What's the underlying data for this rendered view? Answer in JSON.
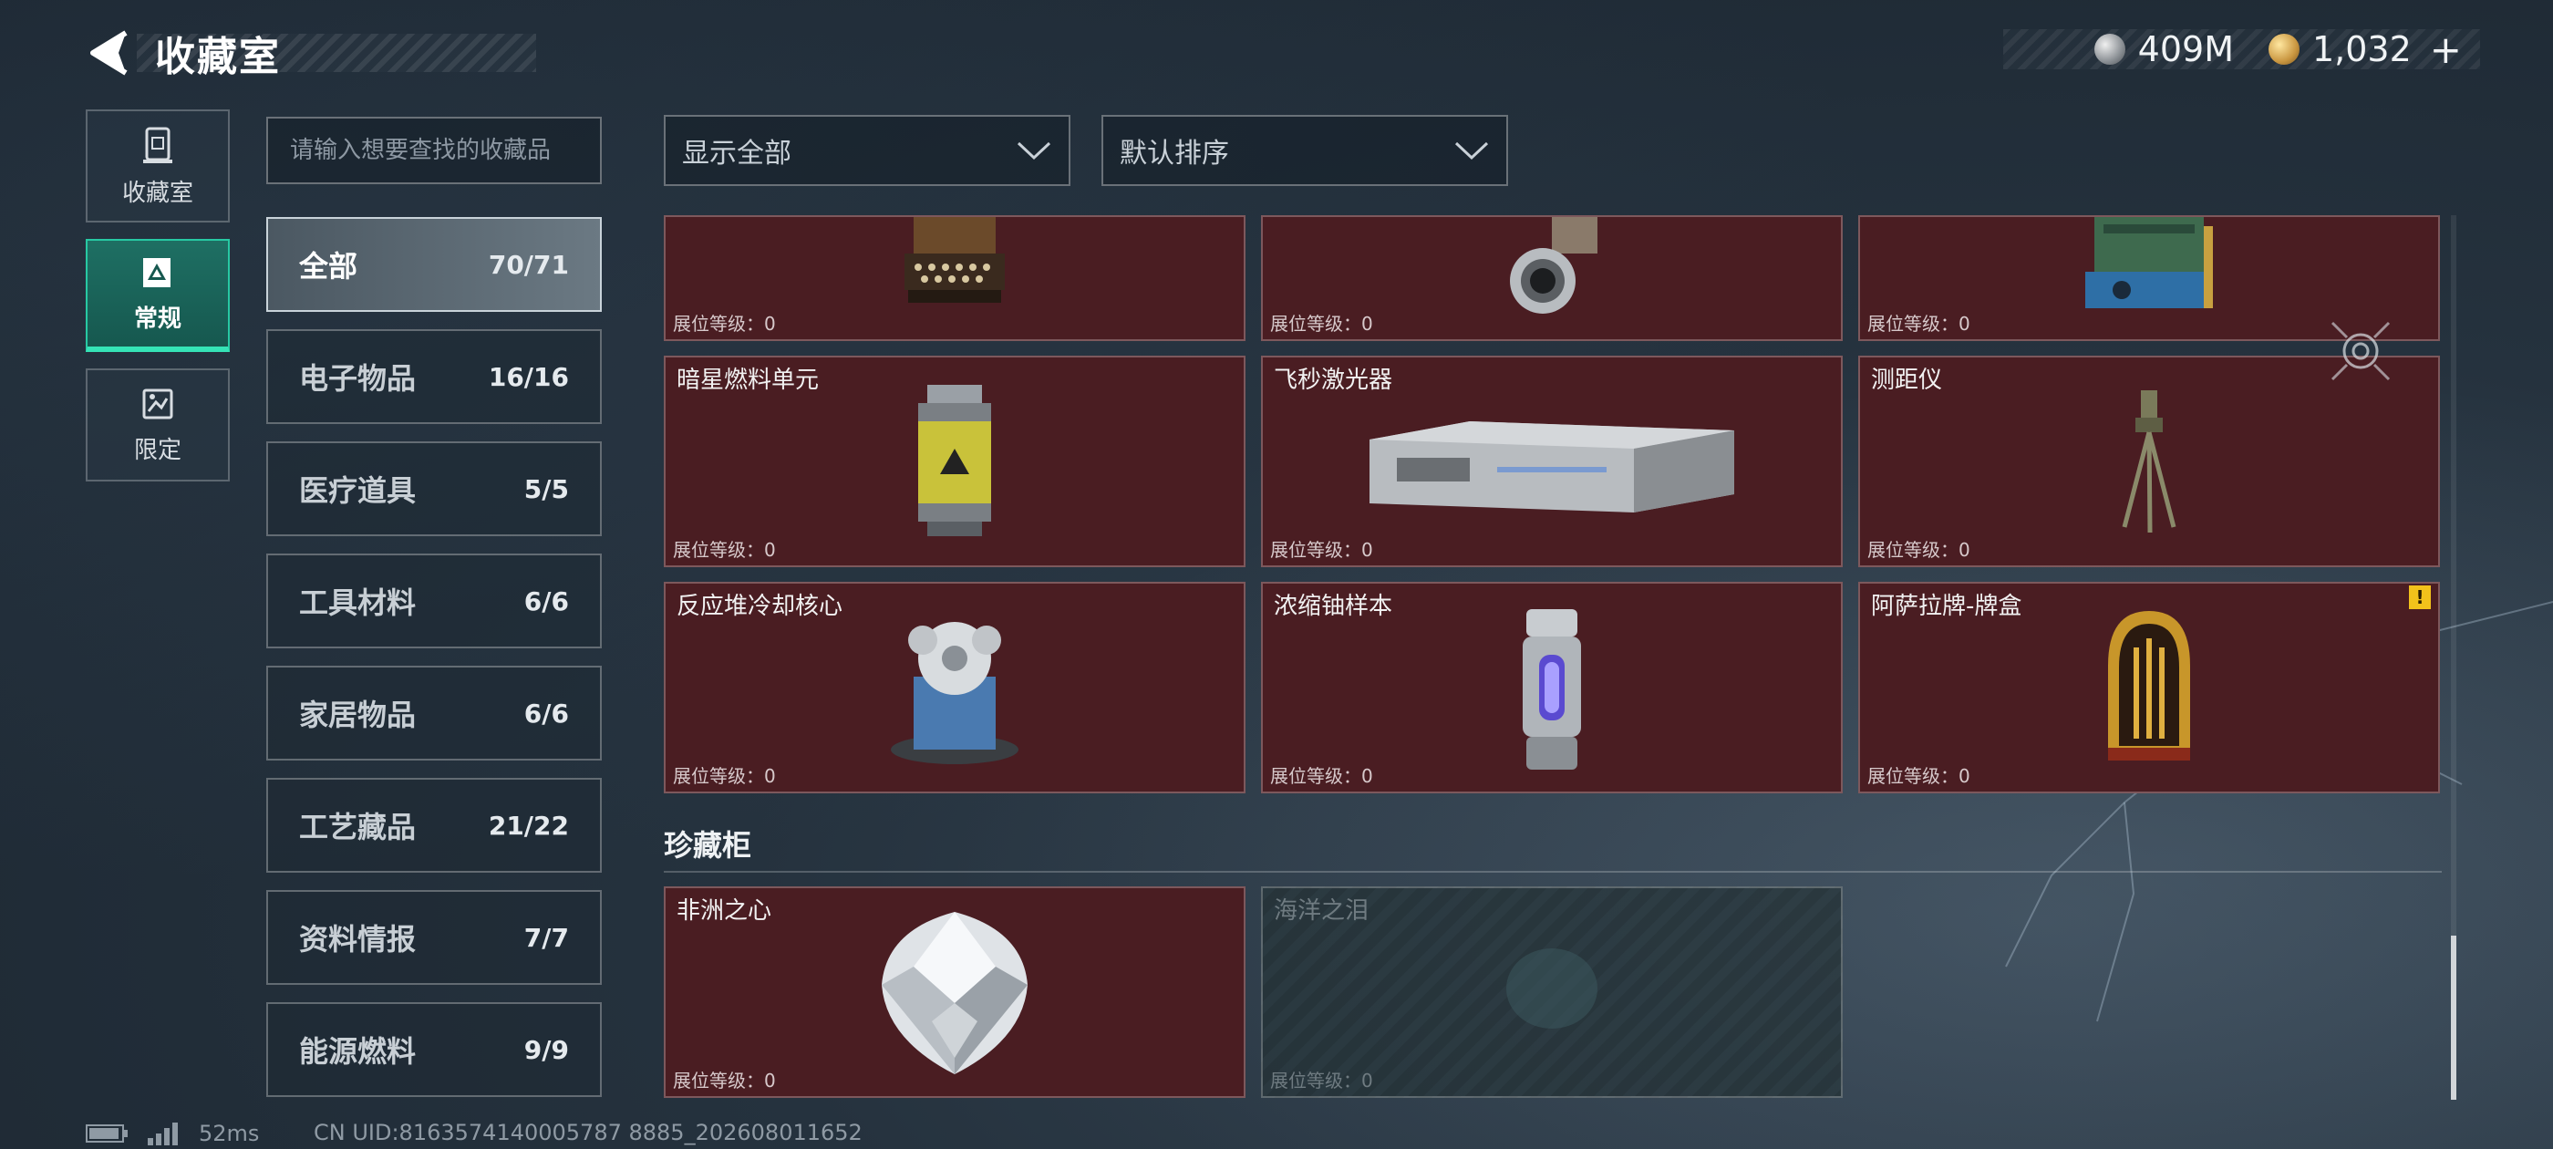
{
  "header": {
    "title": "收藏室"
  },
  "currency": {
    "silver": {
      "icon": "silver-coin-icon",
      "value": "409M"
    },
    "gold": {
      "icon": "gold-coin-icon",
      "value": "1,032"
    },
    "add": "+"
  },
  "mode_tabs": [
    {
      "label": "收藏室",
      "icon": "collection-room-icon"
    },
    {
      "label": "常规",
      "icon": "regular-icon",
      "active": true
    },
    {
      "label": "限定",
      "icon": "limited-icon"
    }
  ],
  "search": {
    "placeholder": "请输入想要查找的收藏品"
  },
  "filters": {
    "show": "显示全部",
    "sort": "默认排序"
  },
  "categories": [
    {
      "name": "全部",
      "count": "70/71",
      "active": true
    },
    {
      "name": "电子物品",
      "count": "16/16"
    },
    {
      "name": "医疗道具",
      "count": "5/5"
    },
    {
      "name": "工具材料",
      "count": "6/6"
    },
    {
      "name": "家居物品",
      "count": "6/6"
    },
    {
      "name": "工艺藏品",
      "count": "21/22"
    },
    {
      "name": "资料情报",
      "count": "7/7"
    },
    {
      "name": "能源燃料",
      "count": "9/9"
    }
  ],
  "level_label": "展位等级：0",
  "grid": {
    "row0": [
      {
        "name": "",
        "icon": "typewriter-icon"
      },
      {
        "name": "",
        "icon": "lens-device-icon"
      },
      {
        "name": "",
        "icon": "machine-icon"
      }
    ],
    "row1": [
      {
        "name": "暗星燃料单元",
        "icon": "fuel-canister-icon"
      },
      {
        "name": "飞秒激光器",
        "icon": "laser-case-icon"
      },
      {
        "name": "测距仪",
        "icon": "tripod-rangefinder-icon"
      }
    ],
    "row2": [
      {
        "name": "反应堆冷却核心",
        "icon": "reactor-core-icon"
      },
      {
        "name": "浓缩铀样本",
        "icon": "uranium-capsule-icon"
      },
      {
        "name": "阿萨拉牌-牌盒",
        "icon": "card-box-icon",
        "alert": "!"
      }
    ]
  },
  "treasure": {
    "title": "珍藏柜",
    "items": [
      {
        "name": "非洲之心",
        "icon": "diamond-icon"
      },
      {
        "name": "海洋之泪",
        "icon": "tear-gem-icon",
        "locked": true
      }
    ]
  },
  "footer": {
    "ping": "52ms",
    "uid": "CN UID:8163574140005787 8885_202608011652"
  }
}
